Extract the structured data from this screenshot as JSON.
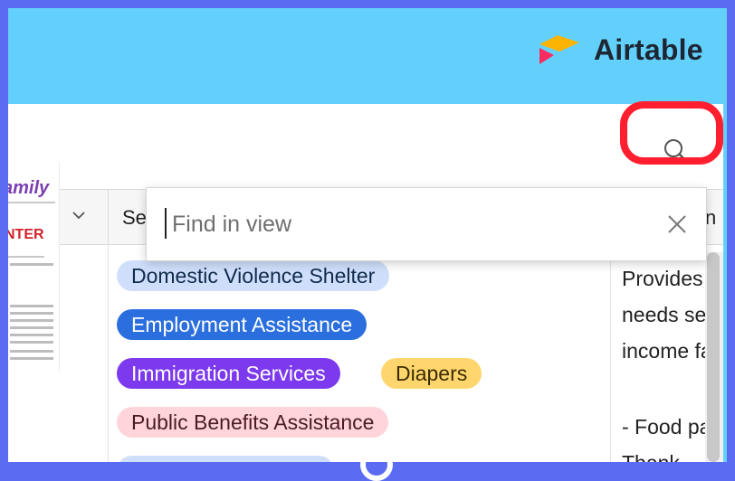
{
  "brand": {
    "name": "Airtable"
  },
  "toolbar": {
    "search_icon": "search-icon"
  },
  "table": {
    "columns": [
      {
        "label": ""
      },
      {
        "label": "Se"
      },
      {
        "label": "n"
      }
    ]
  },
  "find": {
    "placeholder": "Find in view",
    "value": ""
  },
  "thumbnail": {
    "title": "amily",
    "center": "NTER"
  },
  "tags": [
    {
      "label": "Domestic Violence Shelter",
      "bg": "#cfdffb",
      "color": "#102a4c"
    },
    {
      "label": "Employment Assistance",
      "bg": "#2b6fde",
      "color": "#ffffff"
    },
    {
      "label": "Immigration Services",
      "bg": "#7c39ed",
      "color": "#ffffff"
    },
    {
      "label": "Diapers",
      "bg": "#ffd66e",
      "color": "#3b2c00"
    },
    {
      "label": "Public Benefits Assistance",
      "bg": "#ffd4da",
      "color": "#4c1b24"
    }
  ],
  "description": {
    "lines": [
      "Provides a",
      "needs ser",
      "income fa",
      "",
      "- Food pa",
      "Thank"
    ]
  },
  "colors": {
    "background": "#63d0fb",
    "border": "#5b6cf2",
    "highlight": "#ff1f2e"
  }
}
